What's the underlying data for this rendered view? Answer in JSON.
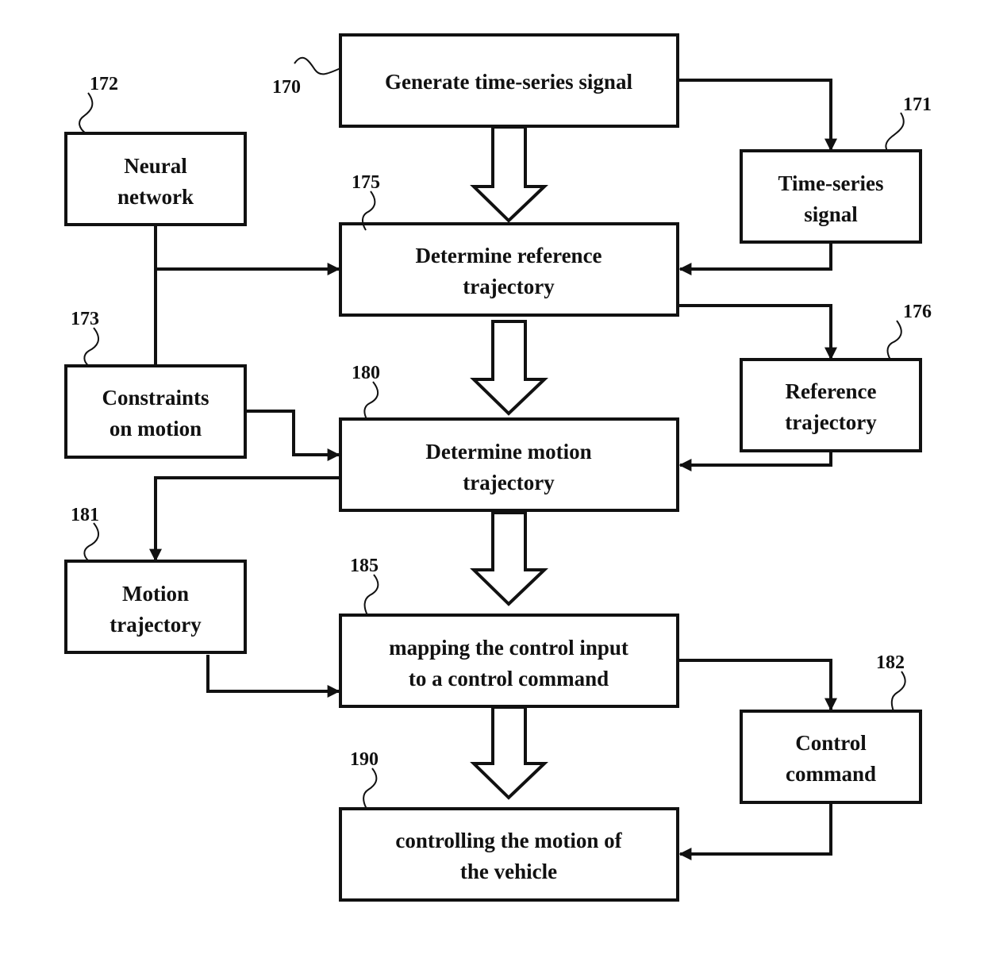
{
  "diagram": {
    "type": "flowchart",
    "blocks": {
      "generate_signal": {
        "ref": "170",
        "lines": [
          "Generate time-series signal"
        ]
      },
      "time_series_signal": {
        "ref": "171",
        "lines": [
          "Time-series",
          "signal"
        ]
      },
      "neural_network": {
        "ref": "172",
        "lines": [
          "Neural",
          "network"
        ]
      },
      "constraints": {
        "ref": "173",
        "lines": [
          "Constraints",
          "on motion"
        ]
      },
      "determine_reference": {
        "ref": "175",
        "lines": [
          "Determine reference",
          "trajectory"
        ]
      },
      "reference_trajectory": {
        "ref": "176",
        "lines": [
          "Reference",
          "trajectory"
        ]
      },
      "determine_motion": {
        "ref": "180",
        "lines": [
          "Determine motion",
          "trajectory"
        ]
      },
      "motion_trajectory": {
        "ref": "181",
        "lines": [
          "Motion",
          "trajectory"
        ]
      },
      "mapping": {
        "ref": "185",
        "lines": [
          "mapping the control input",
          "to a control command"
        ]
      },
      "control_command": {
        "ref": "182",
        "lines": [
          "Control",
          "command"
        ]
      },
      "controlling": {
        "ref": "190",
        "lines": [
          "controlling the motion of",
          "the vehicle"
        ]
      }
    },
    "edges": [
      {
        "from": "generate_signal",
        "to": "determine_reference",
        "style": "block-arrow"
      },
      {
        "from": "generate_signal",
        "to": "time_series_signal",
        "style": "line-arrow"
      },
      {
        "from": "time_series_signal",
        "to": "determine_reference",
        "style": "line-arrow"
      },
      {
        "from": "neural_network",
        "to": "determine_reference",
        "style": "line-arrow"
      },
      {
        "from": "constraints",
        "to": "determine_reference",
        "style": "line-arrow"
      },
      {
        "from": "determine_reference",
        "to": "determine_motion",
        "style": "block-arrow"
      },
      {
        "from": "determine_reference",
        "to": "reference_trajectory",
        "style": "line-arrow"
      },
      {
        "from": "reference_trajectory",
        "to": "determine_motion",
        "style": "line-arrow"
      },
      {
        "from": "constraints",
        "to": "determine_motion",
        "style": "line-arrow"
      },
      {
        "from": "determine_motion",
        "to": "motion_trajectory",
        "style": "line-arrow"
      },
      {
        "from": "determine_motion",
        "to": "mapping",
        "style": "block-arrow"
      },
      {
        "from": "motion_trajectory",
        "to": "mapping",
        "style": "line-arrow"
      },
      {
        "from": "mapping",
        "to": "control_command",
        "style": "line-arrow"
      },
      {
        "from": "mapping",
        "to": "controlling",
        "style": "block-arrow"
      },
      {
        "from": "control_command",
        "to": "controlling",
        "style": "line-arrow"
      }
    ]
  }
}
